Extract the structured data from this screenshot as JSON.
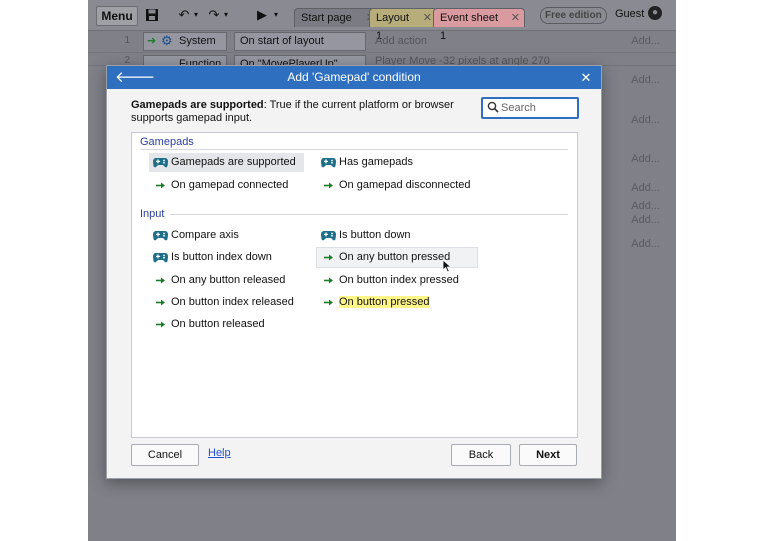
{
  "app": {
    "menu_label": "Menu",
    "tabs": [
      {
        "label": "Start page",
        "close": "✕"
      },
      {
        "label": "Layout 1",
        "close": "✕"
      },
      {
        "label": "Event sheet 1",
        "close": "✕"
      }
    ],
    "edition_badge": "Free edition",
    "user": "Guest",
    "events": [
      {
        "number": "1",
        "object": "System",
        "condition": "On start of layout",
        "action": "Add action",
        "add": "Add..."
      },
      {
        "number": "2",
        "object": "Function",
        "condition": "On \"MovePlayerUp\"",
        "action": "Player    Move -32 pixels at angle 270",
        "add": ""
      }
    ],
    "add_labels": [
      "Add...",
      "Add...",
      "Add...",
      "Add...",
      "Add...",
      "Add...",
      "Add..."
    ]
  },
  "dialog": {
    "title": "Add 'Gamepad' condition",
    "description_bold": "Gamepads are supported",
    "description_rest": ": True if the current platform or browser supports gamepad input.",
    "search_placeholder": "Search",
    "sections": [
      {
        "name": "Gamepads",
        "items": [
          {
            "label": "Gamepads are supported",
            "icon": "gamepad-icon"
          },
          {
            "label": "Has gamepads",
            "icon": "gamepad-icon"
          },
          {
            "label": "On gamepad connected",
            "icon": "trigger-arrow-icon"
          },
          {
            "label": "On gamepad disconnected",
            "icon": "trigger-arrow-icon"
          }
        ]
      },
      {
        "name": "Input",
        "items": [
          {
            "label": "Compare axis",
            "icon": "gamepad-icon"
          },
          {
            "label": "Is button down",
            "icon": "gamepad-icon"
          },
          {
            "label": "Is button index down",
            "icon": "gamepad-icon"
          },
          {
            "label": "On any button pressed",
            "icon": "trigger-arrow-icon"
          },
          {
            "label": "On any button released",
            "icon": "trigger-arrow-icon"
          },
          {
            "label": "On button index pressed",
            "icon": "trigger-arrow-icon"
          },
          {
            "label": "On button index released",
            "icon": "trigger-arrow-icon"
          },
          {
            "label": "On button pressed",
            "icon": "trigger-arrow-icon"
          },
          {
            "label": "On button released",
            "icon": "trigger-arrow-icon"
          }
        ]
      }
    ],
    "buttons": {
      "cancel": "Cancel",
      "help": "Help",
      "back": "Back",
      "next": "Next"
    },
    "colors": {
      "accent": "#2f6fc0",
      "section": "#2a3f9e",
      "trigger": "#1b7e28",
      "gamepad": "#1f6f8b",
      "highlight": "#fff68a"
    }
  }
}
